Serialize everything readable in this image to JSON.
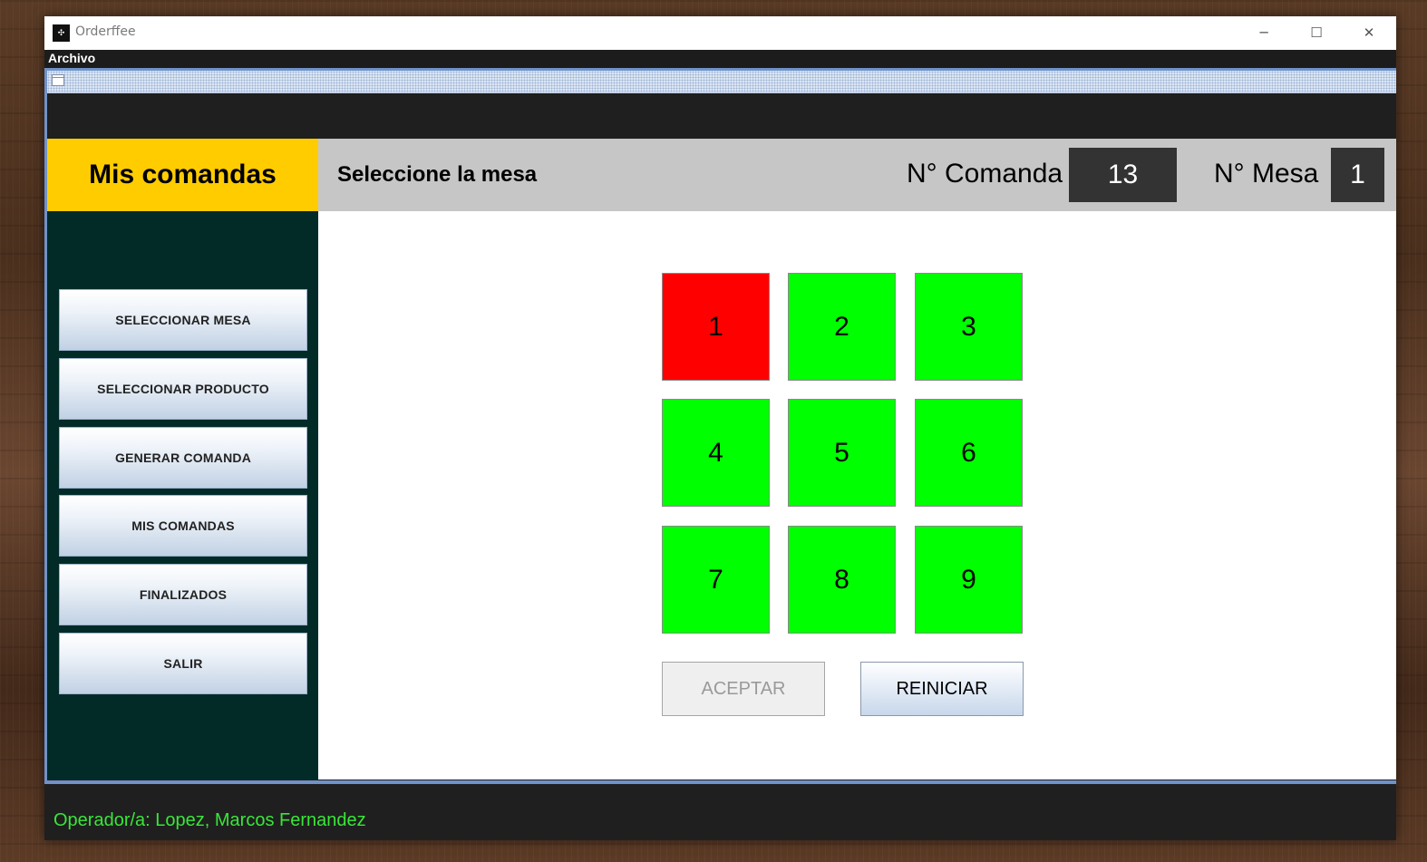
{
  "window": {
    "title": "Orderffee",
    "icon": "app-logo-icon",
    "controls": {
      "minimize": "─",
      "maximize": "☐",
      "close": "✕"
    }
  },
  "menu": {
    "items": [
      "Archivo"
    ]
  },
  "header": {
    "section_title": "Mis comandas",
    "subtitle": "Seleccione la mesa",
    "comanda_label": "N° Comanda",
    "comanda_value": "13",
    "mesa_label": "N° Mesa",
    "mesa_value": "1"
  },
  "sidebar": {
    "items": [
      {
        "label": "SELECCIONAR MESA"
      },
      {
        "label": "SELECCIONAR PRODUCTO"
      },
      {
        "label": "GENERAR COMANDA"
      },
      {
        "label": "MIS COMANDAS"
      },
      {
        "label": "FINALIZADOS"
      },
      {
        "label": "SALIR"
      }
    ]
  },
  "tables": [
    {
      "number": "1",
      "status": "occupied"
    },
    {
      "number": "2",
      "status": "free"
    },
    {
      "number": "3",
      "status": "free"
    },
    {
      "number": "4",
      "status": "free"
    },
    {
      "number": "5",
      "status": "free"
    },
    {
      "number": "6",
      "status": "free"
    },
    {
      "number": "7",
      "status": "free"
    },
    {
      "number": "8",
      "status": "free"
    },
    {
      "number": "9",
      "status": "free"
    }
  ],
  "actions": {
    "accept_label": "ACEPTAR",
    "accept_enabled": false,
    "reset_label": "REINICIAR",
    "reset_enabled": true
  },
  "status": {
    "operator": "Operador/a: Lopez, Marcos Fernandez"
  },
  "colors": {
    "header_accent": "#ffcc00",
    "sidebar_bg": "#022b28",
    "table_occupied": "#ff0000",
    "table_free": "#00ff00",
    "value_box": "#333333",
    "operator_text": "#39e639"
  }
}
